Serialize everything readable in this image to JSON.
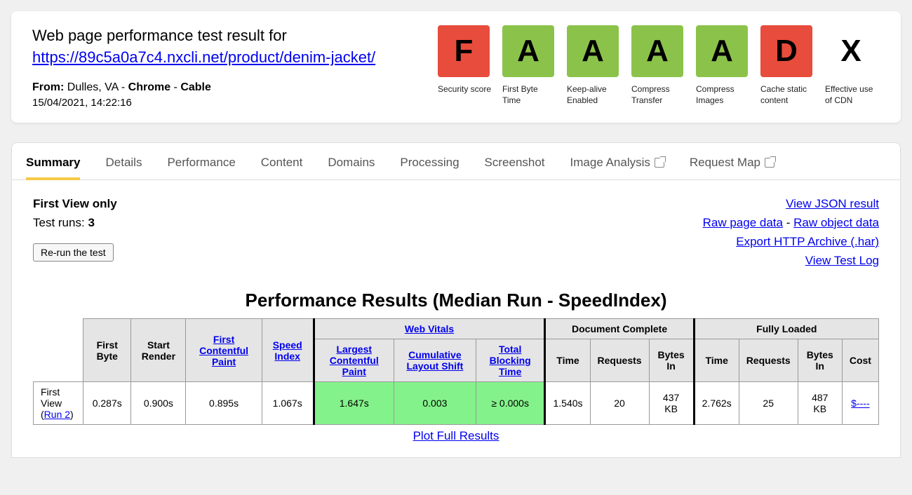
{
  "header": {
    "title_prefix": "Web page performance test result for",
    "url": "https://89c5a0a7c4.nxcli.net/product/denim-jacket/",
    "from_label": "From:",
    "from_location": "Dulles, VA",
    "from_browser": "Chrome",
    "from_connection": "Cable",
    "timestamp": "15/04/2021, 14:22:16"
  },
  "grades": [
    {
      "letter": "F",
      "class": "grade-f",
      "label": "Security score"
    },
    {
      "letter": "A",
      "class": "grade-a",
      "label": "First Byte Time"
    },
    {
      "letter": "A",
      "class": "grade-a",
      "label": "Keep-alive Enabled"
    },
    {
      "letter": "A",
      "class": "grade-a",
      "label": "Compress Transfer"
    },
    {
      "letter": "A",
      "class": "grade-a",
      "label": "Compress Images"
    },
    {
      "letter": "D",
      "class": "grade-d",
      "label": "Cache static content"
    },
    {
      "letter": "X",
      "class": "grade-x",
      "label": "Effective use of CDN"
    }
  ],
  "tabs": [
    {
      "label": "Summary",
      "active": true,
      "external": false
    },
    {
      "label": "Details",
      "active": false,
      "external": false
    },
    {
      "label": "Performance",
      "active": false,
      "external": false
    },
    {
      "label": "Content",
      "active": false,
      "external": false
    },
    {
      "label": "Domains",
      "active": false,
      "external": false
    },
    {
      "label": "Processing",
      "active": false,
      "external": false
    },
    {
      "label": "Screenshot",
      "active": false,
      "external": false
    },
    {
      "label": "Image Analysis",
      "active": false,
      "external": true
    },
    {
      "label": "Request Map",
      "active": false,
      "external": true
    }
  ],
  "summary": {
    "view_mode": "First View only",
    "runs_label": "Test runs:",
    "runs": "3",
    "rerun_label": "Re-run the test",
    "links": {
      "view_json": "View JSON result",
      "raw_page": "Raw page data",
      "dash": " - ",
      "raw_object": "Raw object data",
      "export_har": "Export HTTP Archive (.har)",
      "view_log": "View Test Log"
    }
  },
  "perf": {
    "title": "Performance Results (Median Run - SpeedIndex)",
    "group_headers": {
      "vitals": "Web Vitals",
      "doc_complete": "Document Complete",
      "fully_loaded": "Fully Loaded"
    },
    "col_headers": {
      "first_byte": "First Byte",
      "start_render": "Start Render",
      "fcp": "First Contentful Paint",
      "speed_index": "Speed Index",
      "lcp": "Largest Contentful Paint",
      "cls": "Cumulative Layout Shift",
      "tbt": "Total Blocking Time",
      "time": "Time",
      "requests": "Requests",
      "bytes_in": "Bytes In",
      "cost": "Cost"
    },
    "row": {
      "label_prefix": "First View (",
      "label_link": "Run 2",
      "label_suffix": ")",
      "first_byte": "0.287s",
      "start_render": "0.900s",
      "fcp": "0.895s",
      "speed_index": "1.067s",
      "lcp": "1.647s",
      "cls": "0.003",
      "tbt": "≥ 0.000s",
      "dc_time": "1.540s",
      "dc_requests": "20",
      "dc_bytes": "437 KB",
      "fl_time": "2.762s",
      "fl_requests": "25",
      "fl_bytes": "487 KB",
      "cost": "$----"
    },
    "plot_link": "Plot Full Results"
  }
}
